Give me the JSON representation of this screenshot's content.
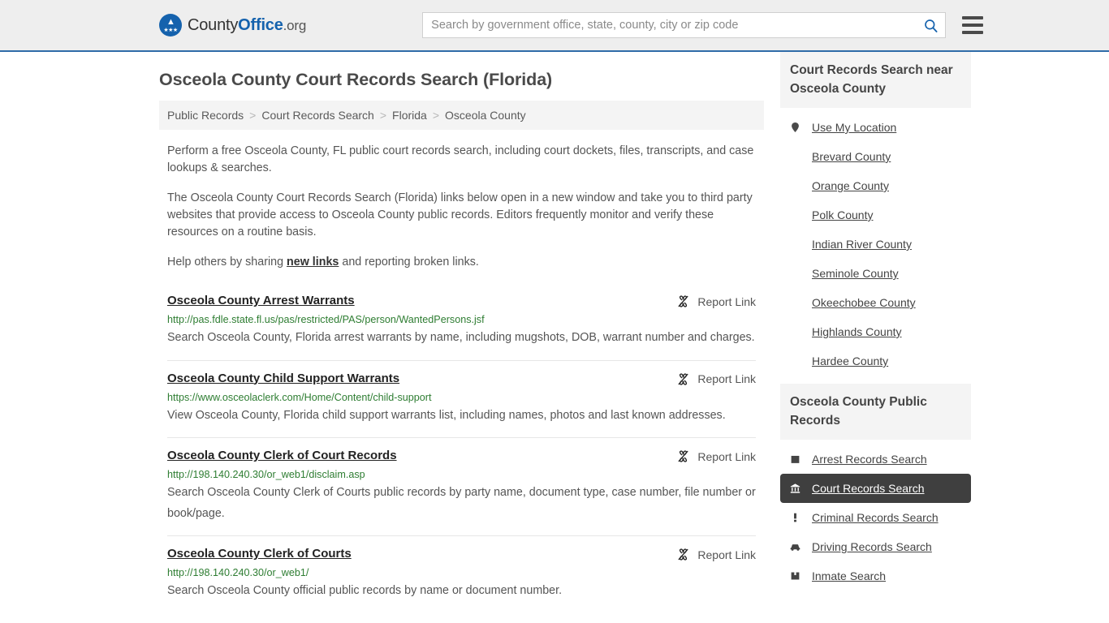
{
  "header": {
    "brand": {
      "county": "County",
      "office": "Office",
      "org": ".org"
    },
    "search": {
      "placeholder": "Search by government office, state, county, city or zip code",
      "value": ""
    },
    "menu_label": "menu"
  },
  "page_title": "Osceola County Court Records Search (Florida)",
  "breadcrumb": {
    "items": [
      {
        "label": "Public Records"
      },
      {
        "label": "Court Records Search"
      },
      {
        "label": "Florida"
      },
      {
        "label": "Osceola County"
      }
    ],
    "separator": ">"
  },
  "intro": {
    "p1": "Perform a free Osceola County, FL public court records search, including court dockets, files, transcripts, and case lookups & searches.",
    "p2": "The Osceola County Court Records Search (Florida) links below open in a new window and take you to third party websites that provide access to Osceola County public records. Editors frequently monitor and verify these resources on a routine basis.",
    "p3_before": "Help others by sharing ",
    "p3_link": "new links",
    "p3_after": " and reporting broken links."
  },
  "report_link_label": "Report Link",
  "results": [
    {
      "title": "Osceola County Arrest Warrants",
      "url": "http://pas.fdle.state.fl.us/pas/restricted/PAS/person/WantedPersons.jsf",
      "description": "Search Osceola County, Florida arrest warrants by name, including mugshots, DOB, warrant number and charges."
    },
    {
      "title": "Osceola County Child Support Warrants",
      "url": "https://www.osceolaclerk.com/Home/Content/child-support",
      "description": "View Osceola County, Florida child support warrants list, including names, photos and last known addresses."
    },
    {
      "title": "Osceola County Clerk of Court Records",
      "url": "http://198.140.240.30/or_web1/disclaim.asp",
      "description": "Search Osceola County Clerk of Courts public records by party name, document type, case number, file number or book/page."
    },
    {
      "title": "Osceola County Clerk of Courts",
      "url": "http://198.140.240.30/or_web1/",
      "description": "Search Osceola County official public records by name or document number."
    }
  ],
  "sidebar": {
    "nearby": {
      "heading": "Court Records Search near Osceola County",
      "items": [
        {
          "label": "Use My Location",
          "icon": "map-pin-icon"
        },
        {
          "label": "Brevard County",
          "icon": ""
        },
        {
          "label": "Orange County",
          "icon": ""
        },
        {
          "label": "Polk County",
          "icon": ""
        },
        {
          "label": "Indian River County",
          "icon": ""
        },
        {
          "label": "Seminole County",
          "icon": ""
        },
        {
          "label": "Okeechobee County",
          "icon": ""
        },
        {
          "label": "Highlands County",
          "icon": ""
        },
        {
          "label": "Hardee County",
          "icon": ""
        }
      ]
    },
    "public_records": {
      "heading": "Osceola County Public Records",
      "items": [
        {
          "label": "Arrest Records Search",
          "icon": "square-icon",
          "active": false
        },
        {
          "label": "Court Records Search",
          "icon": "courthouse-icon",
          "active": true
        },
        {
          "label": "Criminal Records Search",
          "icon": "exclamation-icon",
          "active": false
        },
        {
          "label": "Driving Records Search",
          "icon": "car-icon",
          "active": false
        },
        {
          "label": "Inmate Search",
          "icon": "inmate-icon",
          "active": false
        }
      ]
    }
  },
  "colors": {
    "brand_blue": "#1562ad",
    "header_bg": "#eeeeee",
    "header_border": "#2f6ca8",
    "url_green": "#2e7d32",
    "active_bg": "#3f3f3f",
    "panel_bg": "#f4f4f4"
  }
}
